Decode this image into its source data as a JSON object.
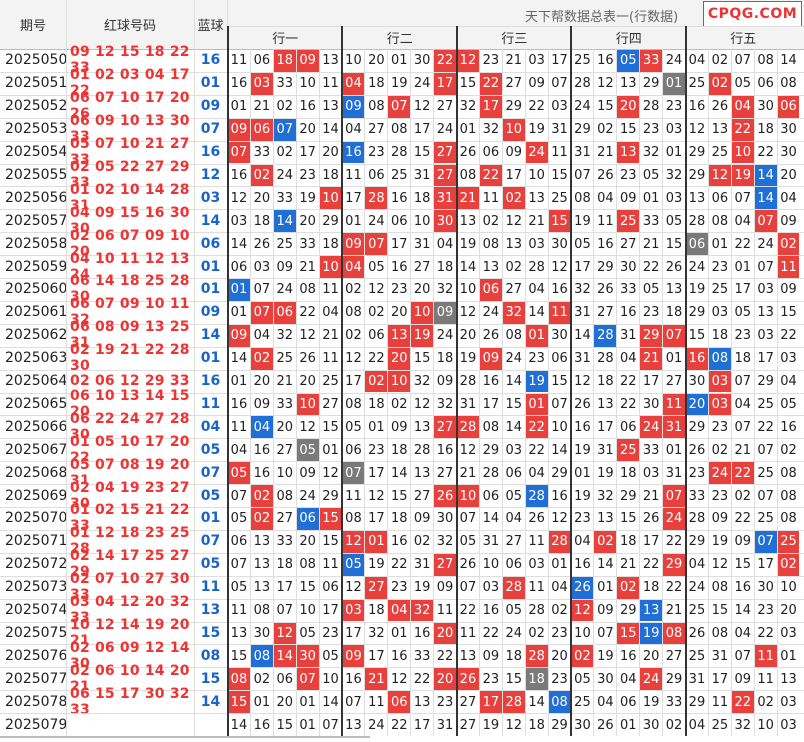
{
  "header": {
    "period_label": "期号",
    "red_label": "红球号码",
    "blue_label": "蓝球",
    "title": "天下帮数据总表一(行数据)",
    "logo": "CPQG.COM",
    "groups": [
      "行一",
      "行二",
      "行三",
      "行四",
      "行五"
    ]
  },
  "colors": {
    "red": "#e8403c",
    "blue": "#1f6fd6",
    "gray": "#7a7a7a",
    "red_text": "#e33",
    "blue_text": "#1a64c8"
  },
  "rows": [
    {
      "period": "2025050",
      "reds": "09 12 15 18 22 33",
      "blue": "16",
      "cells": [
        "11",
        "06",
        "18",
        "09",
        "13",
        "10",
        "20",
        "01",
        "30",
        "22",
        "12",
        "23",
        "21",
        "03",
        "17",
        "25",
        "16",
        "05",
        "33",
        "24",
        "04",
        "02",
        "07",
        "08",
        "14"
      ],
      "marks": "..RR.....RR......BR.........."
    },
    {
      "period": "2025051",
      "reds": "01 02 03 04 17 22",
      "blue": "01",
      "cells": [
        "16",
        "03",
        "33",
        "10",
        "11",
        "04",
        "18",
        "19",
        "24",
        "17",
        "15",
        "22",
        "27",
        "09",
        "07",
        "28",
        "12",
        "13",
        "29",
        "01",
        "25",
        "02",
        "05",
        "06",
        "08"
      ],
      "marks": ".R...R...R.R.......G.R..."
    },
    {
      "period": "2025052",
      "reds": "06 07 10 17 20 26",
      "blue": "09",
      "cells": [
        "01",
        "21",
        "02",
        "16",
        "13",
        "09",
        "08",
        "07",
        "12",
        "27",
        "32",
        "17",
        "29",
        "22",
        "03",
        "24",
        "15",
        "20",
        "28",
        "23",
        "16",
        "26",
        "04",
        "30",
        "06"
      ],
      "marks": ".....B.R...R.....R....R.R"
    },
    {
      "period": "2025053",
      "reds": "06 09 10 13 30 33",
      "blue": "07",
      "cells": [
        "09",
        "06",
        "07",
        "20",
        "14",
        "04",
        "27",
        "08",
        "17",
        "24",
        "01",
        "32",
        "10",
        "19",
        "31",
        "29",
        "02",
        "15",
        "23",
        "03",
        "12",
        "13",
        "22",
        "18",
        "30"
      ],
      "marks": "RRB.........R.........R..R"
    },
    {
      "period": "2025054",
      "reds": "05 07 10 21 27 33",
      "blue": "16",
      "cells": [
        "07",
        "33",
        "02",
        "17",
        "20",
        "16",
        "23",
        "28",
        "15",
        "27",
        "26",
        "06",
        "09",
        "24",
        "11",
        "31",
        "21",
        "13",
        "32",
        "01",
        "29",
        "25",
        "10",
        "22",
        "30"
      ],
      "marks": "R....B...R...R...R....R.."
    },
    {
      "period": "2025055",
      "reds": "02 05 22 27 29 33",
      "blue": "12",
      "cells": [
        "16",
        "02",
        "24",
        "23",
        "18",
        "11",
        "06",
        "25",
        "31",
        "27",
        "08",
        "22",
        "17",
        "10",
        "15",
        "07",
        "26",
        "23",
        "05",
        "32",
        "29",
        "12",
        "19",
        "14",
        "20"
      ],
      "marks": ".R.......R.R.........RRB..."
    },
    {
      "period": "2025056",
      "reds": "01 02 10 14 28 31",
      "blue": "03",
      "cells": [
        "12",
        "20",
        "33",
        "19",
        "10",
        "17",
        "28",
        "16",
        "18",
        "31",
        "21",
        "11",
        "02",
        "13",
        "25",
        "08",
        "04",
        "09",
        "01",
        "03",
        "13",
        "06",
        "07",
        "14",
        "04"
      ],
      "marks": "....R.R..RR.R..........B..."
    },
    {
      "period": "2025057",
      "reds": "04 09 15 16 30 30",
      "blue": "14",
      "cells": [
        "03",
        "18",
        "14",
        "20",
        "29",
        "01",
        "24",
        "06",
        "10",
        "30",
        "13",
        "02",
        "12",
        "21",
        "15",
        "19",
        "11",
        "25",
        "33",
        "05",
        "28",
        "08",
        "04",
        "07",
        "09"
      ],
      "marks": "..B......R....R..R.....R.R"
    },
    {
      "period": "2025058",
      "reds": "02 06 07 09 10 20",
      "blue": "06",
      "cells": [
        "14",
        "26",
        "25",
        "33",
        "18",
        "09",
        "07",
        "17",
        "31",
        "04",
        "19",
        "08",
        "13",
        "03",
        "30",
        "05",
        "16",
        "27",
        "21",
        "15",
        "06",
        "01",
        "22",
        "24",
        "02"
      ],
      "marks": ".....RR.............G...R"
    },
    {
      "period": "2025059",
      "reds": "04 10 11 12 13 24",
      "blue": "01",
      "cells": [
        "06",
        "03",
        "09",
        "21",
        "10",
        "04",
        "05",
        "16",
        "27",
        "18",
        "14",
        "13",
        "02",
        "28",
        "12",
        "17",
        "29",
        "30",
        "22",
        "26",
        "24",
        "23",
        "01",
        "07",
        "11"
      ],
      "marks": "....RR..................RBR"
    },
    {
      "period": "2025060",
      "reds": "06 14 18 25 28 30",
      "blue": "01",
      "cells": [
        "01",
        "07",
        "24",
        "08",
        "11",
        "02",
        "12",
        "23",
        "20",
        "32",
        "10",
        "06",
        "27",
        "04",
        "16",
        "32",
        "26",
        "33",
        "05",
        "13",
        "19",
        "25",
        "17",
        "03",
        "09"
      ],
      "marks": "B..........R.............R"
    },
    {
      "period": "2025061",
      "reds": "06 07 09 10 11 32",
      "blue": "09",
      "cells": [
        "01",
        "07",
        "06",
        "22",
        "04",
        "08",
        "02",
        "20",
        "10",
        "09",
        "12",
        "24",
        "32",
        "14",
        "11",
        "31",
        "27",
        "16",
        "23",
        "18",
        "29",
        "03",
        "05",
        "13",
        "15"
      ],
      "marks": ".RR.....RG..R.R........"
    },
    {
      "period": "2025062",
      "reds": "06 08 09 13 25 31",
      "blue": "14",
      "cells": [
        "09",
        "04",
        "32",
        "12",
        "21",
        "02",
        "06",
        "13",
        "19",
        "24",
        "20",
        "26",
        "08",
        "01",
        "30",
        "14",
        "28",
        "31",
        "29",
        "07",
        "15",
        "18",
        "23",
        "03",
        "22"
      ],
      "marks": "R......RR....R..B.RR........"
    },
    {
      "period": "2025063",
      "reds": "02 19 21 22 28 30",
      "blue": "01",
      "cells": [
        "14",
        "02",
        "25",
        "26",
        "11",
        "12",
        "22",
        "20",
        "15",
        "18",
        "19",
        "09",
        "24",
        "23",
        "06",
        "31",
        "28",
        "04",
        "21",
        "01",
        "16",
        "08",
        "18",
        "17",
        "03"
      ],
      "marks": ".R.....R...R......R.RB....."
    },
    {
      "period": "2025064",
      "reds": "02 06 12 29 33",
      "blue": "16",
      "cells": [
        "01",
        "20",
        "21",
        "20",
        "25",
        "17",
        "02",
        "10",
        "32",
        "09",
        "28",
        "16",
        "14",
        "19",
        "15",
        "12",
        "18",
        "22",
        "17",
        "27",
        "30",
        "03",
        "07",
        "29",
        "04"
      ],
      "marks": "......RR.....B.......R.....R"
    },
    {
      "period": "2025065",
      "reds": "06 10 13 14 15 20",
      "blue": "11",
      "cells": [
        "16",
        "09",
        "33",
        "10",
        "27",
        "08",
        "18",
        "02",
        "12",
        "32",
        "31",
        "17",
        "15",
        "01",
        "07",
        "26",
        "13",
        "22",
        "30",
        "11",
        "20",
        "03",
        "04",
        "25",
        "05"
      ],
      "marks": "...R.........R.....RBR....."
    },
    {
      "period": "2025066",
      "reds": "06 22 24 27 28 30",
      "blue": "04",
      "cells": [
        "11",
        "04",
        "20",
        "12",
        "15",
        "05",
        "01",
        "09",
        "13",
        "27",
        "28",
        "08",
        "14",
        "22",
        "10",
        "16",
        "17",
        "06",
        "24",
        "31",
        "29",
        "23",
        "07",
        "22",
        "16"
      ],
      "marks": ".B.......RR..R....RR......"
    },
    {
      "period": "2025067",
      "reds": "01 05 10 17 20 22",
      "blue": "05",
      "cells": [
        "04",
        "16",
        "27",
        "05",
        "01",
        "06",
        "23",
        "18",
        "28",
        "16",
        "12",
        "29",
        "03",
        "22",
        "14",
        "19",
        "31",
        "25",
        "33",
        "01",
        "26",
        "02",
        "21",
        "07",
        "02"
      ],
      "marks": "...G.............R.......R"
    },
    {
      "period": "2025068",
      "reds": "05 07 08 19 20 31",
      "blue": "07",
      "cells": [
        "05",
        "16",
        "10",
        "09",
        "12",
        "07",
        "17",
        "14",
        "13",
        "27",
        "21",
        "28",
        "06",
        "04",
        "29",
        "01",
        "19",
        "18",
        "03",
        "31",
        "23",
        "24",
        "22",
        "25",
        "08"
      ],
      "marks": "R....G...............RR..R"
    },
    {
      "period": "2025069",
      "reds": "02 04 19 23 27 30",
      "blue": "05",
      "cells": [
        "07",
        "02",
        "08",
        "24",
        "29",
        "11",
        "12",
        "15",
        "27",
        "26",
        "10",
        "06",
        "05",
        "28",
        "16",
        "19",
        "32",
        "29",
        "21",
        "07",
        "33",
        "23",
        "02",
        "07",
        "08"
      ],
      "marks": ".R.......RR..B.....R.....R."
    },
    {
      "period": "2025070",
      "reds": "01 02 15 21 22 33",
      "blue": "01",
      "cells": [
        "05",
        "02",
        "27",
        "06",
        "15",
        "08",
        "17",
        "18",
        "09",
        "30",
        "07",
        "14",
        "04",
        "26",
        "12",
        "23",
        "13",
        "15",
        "26",
        "24",
        "28",
        "09",
        "22",
        "25",
        "08"
      ],
      "marks": ".R.BR..............R.....R..."
    },
    {
      "period": "2025071",
      "reds": "01 12 18 23 25 28",
      "blue": "07",
      "cells": [
        "06",
        "13",
        "33",
        "20",
        "15",
        "12",
        "01",
        "16",
        "02",
        "32",
        "05",
        "31",
        "27",
        "11",
        "28",
        "04",
        "02",
        "18",
        "17",
        "22",
        "29",
        "19",
        "09",
        "07",
        "25"
      ],
      "marks": ".....RR.......R.R......BR"
    },
    {
      "period": "2025072",
      "reds": "02 14 17 25 27 29",
      "blue": "05",
      "cells": [
        "07",
        "13",
        "18",
        "08",
        "11",
        "05",
        "19",
        "22",
        "31",
        "27",
        "26",
        "10",
        "06",
        "03",
        "01",
        "16",
        "14",
        "21",
        "22",
        "29",
        "04",
        "12",
        "15",
        "17",
        "02"
      ],
      "marks": ".....B...R.........R....RR"
    },
    {
      "period": "2025073",
      "reds": "02 07 10 27 30 33",
      "blue": "11",
      "cells": [
        "05",
        "13",
        "17",
        "15",
        "06",
        "12",
        "27",
        "23",
        "19",
        "09",
        "07",
        "03",
        "28",
        "11",
        "04",
        "26",
        "01",
        "02",
        "18",
        "22",
        "24",
        "08",
        "16",
        "30",
        "10"
      ],
      "marks": "......R.....R..B.R........RR"
    },
    {
      "period": "2025074",
      "reds": "03 04 12 20 32 33",
      "blue": "13",
      "cells": [
        "11",
        "08",
        "07",
        "10",
        "17",
        "03",
        "18",
        "04",
        "32",
        "11",
        "22",
        "16",
        "05",
        "28",
        "02",
        "12",
        "09",
        "29",
        "13",
        "21",
        "25",
        "15",
        "14",
        "23",
        "20"
      ],
      "marks": ".....R.RR......R..B......."
    },
    {
      "period": "2025075",
      "reds": "10 12 14 19 20 21",
      "blue": "15",
      "cells": [
        "13",
        "30",
        "12",
        "05",
        "23",
        "17",
        "32",
        "01",
        "16",
        "20",
        "11",
        "22",
        "24",
        "02",
        "23",
        "10",
        "07",
        "15",
        "19",
        "08",
        "26",
        "08",
        "04",
        "22",
        "03"
      ],
      "marks": "..R......R.......RBR......"
    },
    {
      "period": "2025076",
      "reds": "02 06 09 12 14 30",
      "blue": "08",
      "cells": [
        "15",
        "08",
        "14",
        "30",
        "05",
        "09",
        "17",
        "16",
        "33",
        "22",
        "13",
        "09",
        "18",
        "28",
        "20",
        "02",
        "19",
        "16",
        "20",
        "27",
        "25",
        "31",
        "07",
        "11",
        "01"
      ],
      "marks": ".BRR.R.......R.R.......R"
    },
    {
      "period": "2025077",
      "reds": "02 06 10 14 20 21",
      "blue": "15",
      "cells": [
        "08",
        "02",
        "06",
        "07",
        "10",
        "16",
        "21",
        "12",
        "22",
        "20",
        "26",
        "23",
        "15",
        "18",
        "23",
        "05",
        "30",
        "04",
        "24",
        "29",
        "31",
        "17",
        "09",
        "11",
        "13"
      ],
      "marks": "R..R..R..RR..G....R........"
    },
    {
      "period": "2025078",
      "reds": "06 15 17 30 32 33",
      "blue": "14",
      "cells": [
        "15",
        "01",
        "20",
        "01",
        "14",
        "07",
        "11",
        "06",
        "13",
        "23",
        "27",
        "17",
        "28",
        "14",
        "08",
        "25",
        "04",
        "06",
        "19",
        "33",
        "29",
        "11",
        "22",
        "02",
        "03"
      ],
      "marks": "R......R...RR.B.......R..."
    },
    {
      "period": "2025079",
      "reds": "",
      "blue": "",
      "cells": [
        "14",
        "16",
        "15",
        "01",
        "07",
        "13",
        "24",
        "22",
        "17",
        "31",
        "27",
        "19",
        "12",
        "18",
        "29",
        "30",
        "26",
        "01",
        "30",
        "02",
        "04",
        "25",
        "32",
        "10",
        "03"
      ],
      "marks": "........................."
    }
  ]
}
